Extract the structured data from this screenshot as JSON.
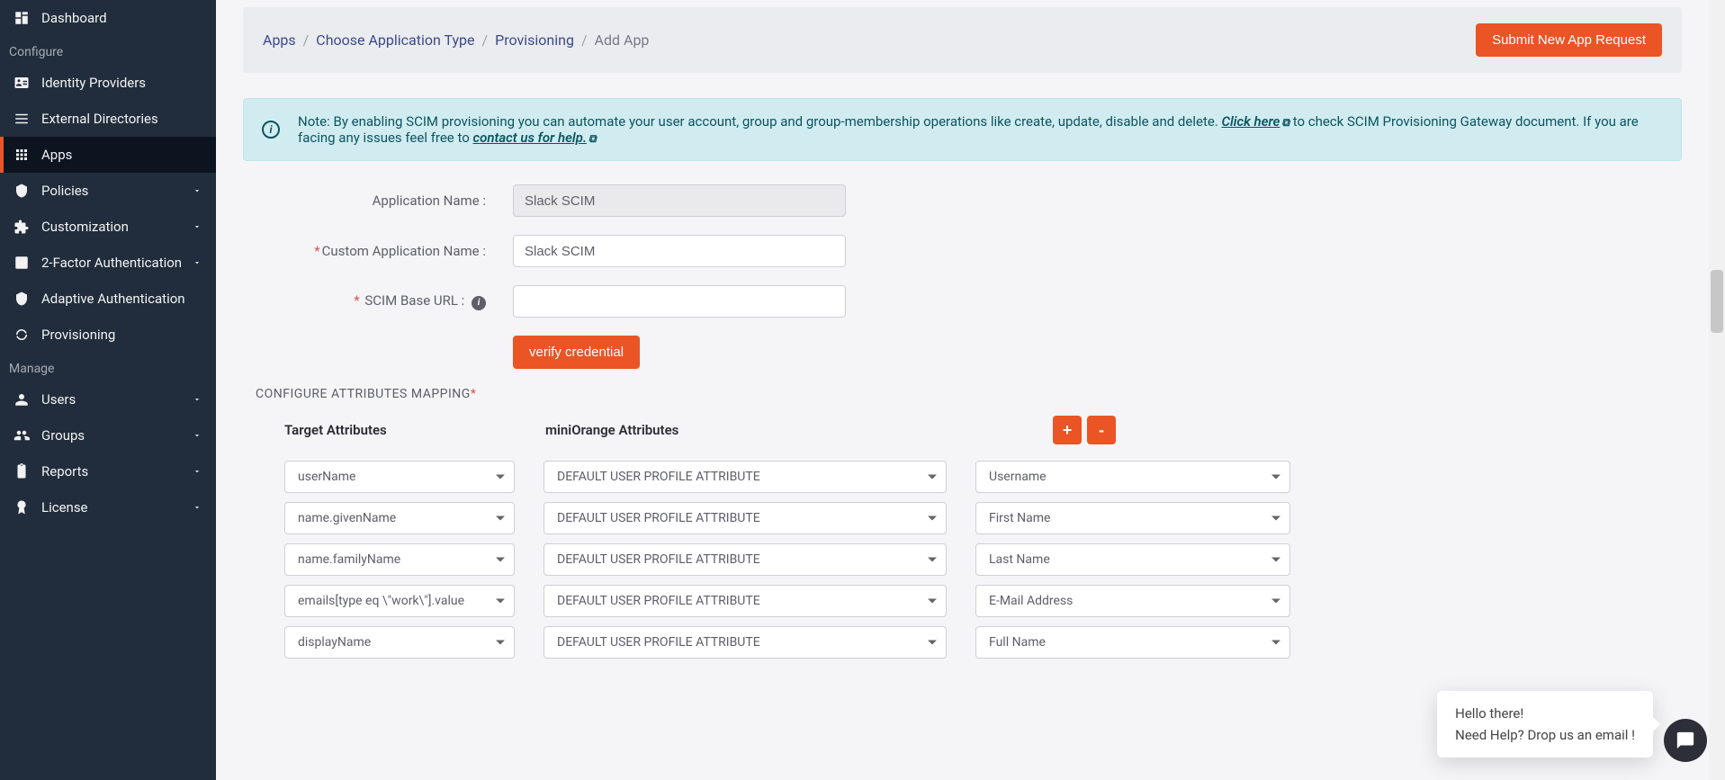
{
  "sidebar": {
    "top": [
      {
        "label": "Dashboard"
      }
    ],
    "section_configure": "Configure",
    "configure": [
      {
        "label": "Identity Providers",
        "chevron": false
      },
      {
        "label": "External Directories",
        "chevron": false
      },
      {
        "label": "Apps",
        "chevron": false,
        "active": true
      },
      {
        "label": "Policies",
        "chevron": true
      },
      {
        "label": "Customization",
        "chevron": true
      },
      {
        "label": "2-Factor Authentication",
        "chevron": true
      },
      {
        "label": "Adaptive Authentication",
        "chevron": false
      },
      {
        "label": "Provisioning",
        "chevron": false
      }
    ],
    "section_manage": "Manage",
    "manage": [
      {
        "label": "Users",
        "chevron": true
      },
      {
        "label": "Groups",
        "chevron": true
      },
      {
        "label": "Reports",
        "chevron": true
      },
      {
        "label": "License",
        "chevron": true
      }
    ]
  },
  "breadcrumb": {
    "items": [
      "Apps",
      "Choose Application Type",
      "Provisioning",
      "Add App"
    ]
  },
  "topbar": {
    "submit_label": "Submit New App Request"
  },
  "note": {
    "prefix": "Note: By enabling SCIM provisioning you can automate your user account, group and group-membership operations like create, update, disable and delete. ",
    "click_here": "Click here",
    "mid": " to check SCIM Provisioning Gateway document. If you are facing any issues feel free to ",
    "contact": "contact us for help.",
    "external_symbol": "⧉"
  },
  "form": {
    "app_name_label": "Application Name :",
    "app_name_value": "Slack SCIM",
    "custom_name_label": "Custom Application Name :",
    "custom_name_value": "Slack SCIM",
    "scim_url_label": " SCIM Base URL :",
    "scim_url_value": "",
    "verify_label": "verify credential"
  },
  "mapping": {
    "heading": "CONFIGURE ATTRIBUTES MAPPING",
    "col_target": "Target Attributes",
    "col_mo": "miniOrange Attributes",
    "plus": "+",
    "minus": "-",
    "default_profile": "DEFAULT USER PROFILE ATTRIBUTE",
    "rows": [
      {
        "target": "userName",
        "value": "Username"
      },
      {
        "target": "name.givenName",
        "value": "First Name"
      },
      {
        "target": "name.familyName",
        "value": "Last Name"
      },
      {
        "target": "emails[type eq \\\"work\\\"].value",
        "value": "E-Mail Address"
      },
      {
        "target": "displayName",
        "value": "Full Name"
      }
    ]
  },
  "help": {
    "line1": "Hello there!",
    "line2": "Need Help? Drop us an email !"
  }
}
